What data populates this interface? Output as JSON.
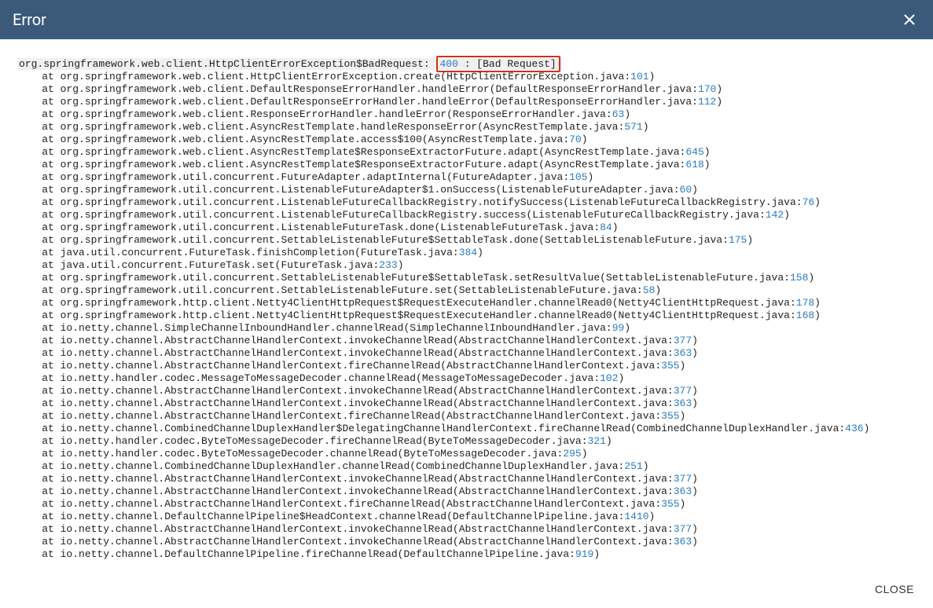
{
  "title": "Error",
  "close_label": "CLOSE",
  "exception_class": "org.springframework.web.client.HttpClientErrorException$BadRequest: ",
  "highlighted": "400 : [Bad Request]",
  "stack": [
    {
      "t": "    at org.springframework.web.client.HttpClientErrorException.create(HttpClientErrorException.java:",
      "n": "101",
      "s": ")"
    },
    {
      "t": "    at org.springframework.web.client.DefaultResponseErrorHandler.handleError(DefaultResponseErrorHandler.java:",
      "n": "170",
      "s": ")"
    },
    {
      "t": "    at org.springframework.web.client.DefaultResponseErrorHandler.handleError(DefaultResponseErrorHandler.java:",
      "n": "112",
      "s": ")"
    },
    {
      "t": "    at org.springframework.web.client.ResponseErrorHandler.handleError(ResponseErrorHandler.java:",
      "n": "63",
      "s": ")"
    },
    {
      "t": "    at org.springframework.web.client.AsyncRestTemplate.handleResponseError(AsyncRestTemplate.java:",
      "n": "571",
      "s": ")"
    },
    {
      "t": "    at org.springframework.web.client.AsyncRestTemplate.access$100(AsyncRestTemplate.java:",
      "n": "70",
      "s": ")"
    },
    {
      "t": "    at org.springframework.web.client.AsyncRestTemplate$ResponseExtractorFuture.adapt(AsyncRestTemplate.java:",
      "n": "645",
      "s": ")"
    },
    {
      "t": "    at org.springframework.web.client.AsyncRestTemplate$ResponseExtractorFuture.adapt(AsyncRestTemplate.java:",
      "n": "618",
      "s": ")"
    },
    {
      "t": "    at org.springframework.util.concurrent.FutureAdapter.adaptInternal(FutureAdapter.java:",
      "n": "105",
      "s": ")"
    },
    {
      "t": "    at org.springframework.util.concurrent.ListenableFutureAdapter$1.onSuccess(ListenableFutureAdapter.java:",
      "n": "60",
      "s": ")"
    },
    {
      "t": "    at org.springframework.util.concurrent.ListenableFutureCallbackRegistry.notifySuccess(ListenableFutureCallbackRegistry.java:",
      "n": "76",
      "s": ")"
    },
    {
      "t": "    at org.springframework.util.concurrent.ListenableFutureCallbackRegistry.success(ListenableFutureCallbackRegistry.java:",
      "n": "142",
      "s": ")"
    },
    {
      "t": "    at org.springframework.util.concurrent.ListenableFutureTask.done(ListenableFutureTask.java:",
      "n": "84",
      "s": ")"
    },
    {
      "t": "    at org.springframework.util.concurrent.SettableListenableFuture$SettableTask.done(SettableListenableFuture.java:",
      "n": "175",
      "s": ")"
    },
    {
      "t": "    at java.util.concurrent.FutureTask.finishCompletion(FutureTask.java:",
      "n": "384",
      "s": ")"
    },
    {
      "t": "    at java.util.concurrent.FutureTask.set(FutureTask.java:",
      "n": "233",
      "s": ")"
    },
    {
      "t": "    at org.springframework.util.concurrent.SettableListenableFuture$SettableTask.setResultValue(SettableListenableFuture.java:",
      "n": "158",
      "s": ")"
    },
    {
      "t": "    at org.springframework.util.concurrent.SettableListenableFuture.set(SettableListenableFuture.java:",
      "n": "58",
      "s": ")"
    },
    {
      "t": "    at org.springframework.http.client.Netty4ClientHttpRequest$RequestExecuteHandler.channelRead0(Netty4ClientHttpRequest.java:",
      "n": "178",
      "s": ")"
    },
    {
      "t": "    at org.springframework.http.client.Netty4ClientHttpRequest$RequestExecuteHandler.channelRead0(Netty4ClientHttpRequest.java:",
      "n": "168",
      "s": ")"
    },
    {
      "t": "    at io.netty.channel.SimpleChannelInboundHandler.channelRead(SimpleChannelInboundHandler.java:",
      "n": "99",
      "s": ")"
    },
    {
      "t": "    at io.netty.channel.AbstractChannelHandlerContext.invokeChannelRead(AbstractChannelHandlerContext.java:",
      "n": "377",
      "s": ")"
    },
    {
      "t": "    at io.netty.channel.AbstractChannelHandlerContext.invokeChannelRead(AbstractChannelHandlerContext.java:",
      "n": "363",
      "s": ")"
    },
    {
      "t": "    at io.netty.channel.AbstractChannelHandlerContext.fireChannelRead(AbstractChannelHandlerContext.java:",
      "n": "355",
      "s": ")"
    },
    {
      "t": "    at io.netty.handler.codec.MessageToMessageDecoder.channelRead(MessageToMessageDecoder.java:",
      "n": "102",
      "s": ")"
    },
    {
      "t": "    at io.netty.channel.AbstractChannelHandlerContext.invokeChannelRead(AbstractChannelHandlerContext.java:",
      "n": "377",
      "s": ")"
    },
    {
      "t": "    at io.netty.channel.AbstractChannelHandlerContext.invokeChannelRead(AbstractChannelHandlerContext.java:",
      "n": "363",
      "s": ")"
    },
    {
      "t": "    at io.netty.channel.AbstractChannelHandlerContext.fireChannelRead(AbstractChannelHandlerContext.java:",
      "n": "355",
      "s": ")"
    },
    {
      "t": "    at io.netty.channel.CombinedChannelDuplexHandler$DelegatingChannelHandlerContext.fireChannelRead(CombinedChannelDuplexHandler.java:",
      "n": "436",
      "s": ")"
    },
    {
      "t": "    at io.netty.handler.codec.ByteToMessageDecoder.fireChannelRead(ByteToMessageDecoder.java:",
      "n": "321",
      "s": ")"
    },
    {
      "t": "    at io.netty.handler.codec.ByteToMessageDecoder.channelRead(ByteToMessageDecoder.java:",
      "n": "295",
      "s": ")"
    },
    {
      "t": "    at io.netty.channel.CombinedChannelDuplexHandler.channelRead(CombinedChannelDuplexHandler.java:",
      "n": "251",
      "s": ")"
    },
    {
      "t": "    at io.netty.channel.AbstractChannelHandlerContext.invokeChannelRead(AbstractChannelHandlerContext.java:",
      "n": "377",
      "s": ")"
    },
    {
      "t": "    at io.netty.channel.AbstractChannelHandlerContext.invokeChannelRead(AbstractChannelHandlerContext.java:",
      "n": "363",
      "s": ")"
    },
    {
      "t": "    at io.netty.channel.AbstractChannelHandlerContext.fireChannelRead(AbstractChannelHandlerContext.java:",
      "n": "355",
      "s": ")"
    },
    {
      "t": "    at io.netty.channel.DefaultChannelPipeline$HeadContext.channelRead(DefaultChannelPipeline.java:",
      "n": "1410",
      "s": ")"
    },
    {
      "t": "    at io.netty.channel.AbstractChannelHandlerContext.invokeChannelRead(AbstractChannelHandlerContext.java:",
      "n": "377",
      "s": ")"
    },
    {
      "t": "    at io.netty.channel.AbstractChannelHandlerContext.invokeChannelRead(AbstractChannelHandlerContext.java:",
      "n": "363",
      "s": ")"
    },
    {
      "t": "    at io.netty.channel.DefaultChannelPipeline.fireChannelRead(DefaultChannelPipeline.java:",
      "n": "919",
      "s": ")"
    }
  ]
}
